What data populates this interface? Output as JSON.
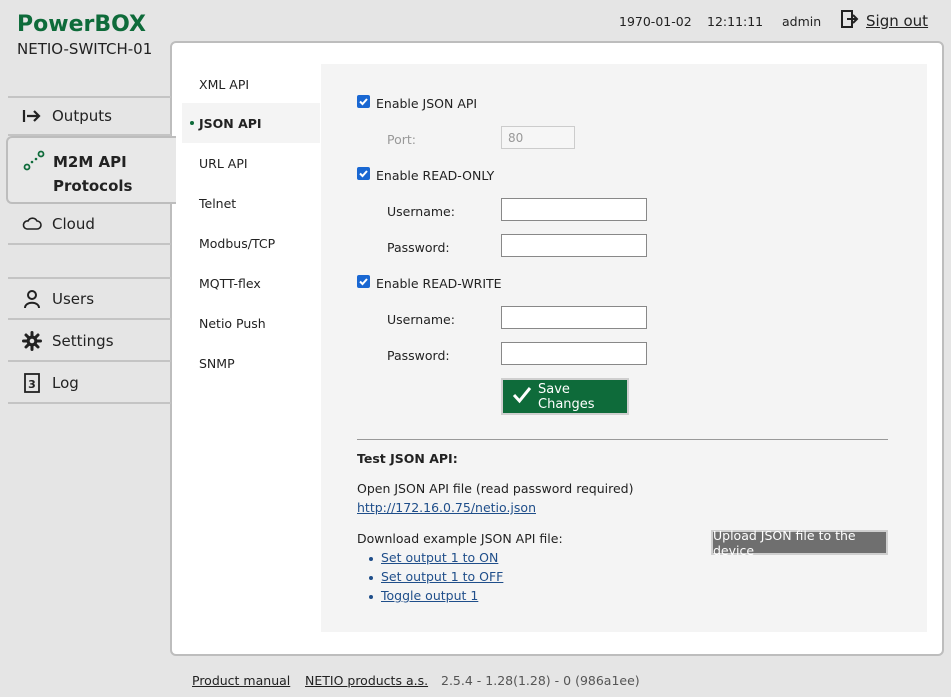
{
  "header": {
    "brand": "PowerBOX",
    "device_name": "NETIO-SWITCH-01",
    "date": "1970-01-02",
    "time": "12:11:11",
    "user": "admin",
    "sign_out": "Sign out",
    "sign_out_icon": "sign-out-icon"
  },
  "sidebar": {
    "items": [
      {
        "label": "Outputs",
        "icon": "outputs-arrow-icon"
      },
      {
        "label_line1": "M2M API",
        "label_line2": "Protocols",
        "icon": "m2m-icon",
        "active": true
      },
      {
        "label": "Cloud",
        "icon": "cloud-icon"
      },
      {
        "label": "Users",
        "icon": "user-icon"
      },
      {
        "label": "Settings",
        "icon": "gear-icon"
      },
      {
        "label": "Log",
        "icon": "log-icon"
      }
    ]
  },
  "subnav": {
    "items": [
      {
        "label": "XML API"
      },
      {
        "label": "JSON API",
        "active": true
      },
      {
        "label": "URL API"
      },
      {
        "label": "Telnet"
      },
      {
        "label": "Modbus/TCP"
      },
      {
        "label": "MQTT-flex"
      },
      {
        "label": "Netio Push"
      },
      {
        "label": "SNMP"
      }
    ]
  },
  "form": {
    "enable_json_api": {
      "label": "Enable JSON API",
      "checked": true
    },
    "port_label": "Port:",
    "port_value": "80",
    "enable_read_only": {
      "label": "Enable READ-ONLY",
      "checked": true
    },
    "ro_username_label": "Username:",
    "ro_username_value": "",
    "ro_password_label": "Password:",
    "ro_password_value": "",
    "enable_read_write": {
      "label": "Enable READ-WRITE",
      "checked": true
    },
    "rw_username_label": "Username:",
    "rw_username_value": "",
    "rw_password_label": "Password:",
    "rw_password_value": "",
    "save_button": "Save Changes"
  },
  "test": {
    "heading": "Test JSON API:",
    "open_text": "Open JSON API file (read password required)",
    "open_link": "http://172.16.0.75/netio.json",
    "download_text": "Download example JSON API file:",
    "downloads": [
      "Set output 1 to ON",
      "Set output 1 to OFF",
      "Toggle output 1"
    ],
    "upload_button": "Upload JSON file to the device"
  },
  "footer": {
    "product_manual": "Product manual",
    "company": "NETIO products a.s.",
    "version": "2.5.4 - 1.28(1.28) - 0 (986a1ee)"
  },
  "colors": {
    "brand_green": "#0e6b3a",
    "checkbox_blue": "#1967d2",
    "link_blue": "#1f4e8a",
    "upload_gray": "#6f6f6f"
  }
}
